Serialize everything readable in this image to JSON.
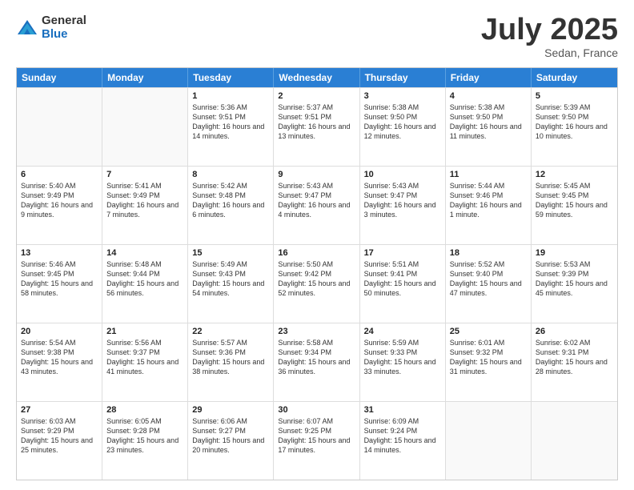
{
  "header": {
    "logo_general": "General",
    "logo_blue": "Blue",
    "month_title": "July 2025",
    "subtitle": "Sedan, France"
  },
  "days_of_week": [
    "Sunday",
    "Monday",
    "Tuesday",
    "Wednesday",
    "Thursday",
    "Friday",
    "Saturday"
  ],
  "weeks": [
    [
      {
        "day": "",
        "empty": true
      },
      {
        "day": "",
        "empty": true
      },
      {
        "day": "1",
        "sunrise": "5:36 AM",
        "sunset": "9:51 PM",
        "daylight": "16 hours and 14 minutes."
      },
      {
        "day": "2",
        "sunrise": "5:37 AM",
        "sunset": "9:51 PM",
        "daylight": "16 hours and 13 minutes."
      },
      {
        "day": "3",
        "sunrise": "5:38 AM",
        "sunset": "9:50 PM",
        "daylight": "16 hours and 12 minutes."
      },
      {
        "day": "4",
        "sunrise": "5:38 AM",
        "sunset": "9:50 PM",
        "daylight": "16 hours and 11 minutes."
      },
      {
        "day": "5",
        "sunrise": "5:39 AM",
        "sunset": "9:50 PM",
        "daylight": "16 hours and 10 minutes."
      }
    ],
    [
      {
        "day": "6",
        "sunrise": "5:40 AM",
        "sunset": "9:49 PM",
        "daylight": "16 hours and 9 minutes."
      },
      {
        "day": "7",
        "sunrise": "5:41 AM",
        "sunset": "9:49 PM",
        "daylight": "16 hours and 7 minutes."
      },
      {
        "day": "8",
        "sunrise": "5:42 AM",
        "sunset": "9:48 PM",
        "daylight": "16 hours and 6 minutes."
      },
      {
        "day": "9",
        "sunrise": "5:43 AM",
        "sunset": "9:47 PM",
        "daylight": "16 hours and 4 minutes."
      },
      {
        "day": "10",
        "sunrise": "5:43 AM",
        "sunset": "9:47 PM",
        "daylight": "16 hours and 3 minutes."
      },
      {
        "day": "11",
        "sunrise": "5:44 AM",
        "sunset": "9:46 PM",
        "daylight": "16 hours and 1 minute."
      },
      {
        "day": "12",
        "sunrise": "5:45 AM",
        "sunset": "9:45 PM",
        "daylight": "15 hours and 59 minutes."
      }
    ],
    [
      {
        "day": "13",
        "sunrise": "5:46 AM",
        "sunset": "9:45 PM",
        "daylight": "15 hours and 58 minutes."
      },
      {
        "day": "14",
        "sunrise": "5:48 AM",
        "sunset": "9:44 PM",
        "daylight": "15 hours and 56 minutes."
      },
      {
        "day": "15",
        "sunrise": "5:49 AM",
        "sunset": "9:43 PM",
        "daylight": "15 hours and 54 minutes."
      },
      {
        "day": "16",
        "sunrise": "5:50 AM",
        "sunset": "9:42 PM",
        "daylight": "15 hours and 52 minutes."
      },
      {
        "day": "17",
        "sunrise": "5:51 AM",
        "sunset": "9:41 PM",
        "daylight": "15 hours and 50 minutes."
      },
      {
        "day": "18",
        "sunrise": "5:52 AM",
        "sunset": "9:40 PM",
        "daylight": "15 hours and 47 minutes."
      },
      {
        "day": "19",
        "sunrise": "5:53 AM",
        "sunset": "9:39 PM",
        "daylight": "15 hours and 45 minutes."
      }
    ],
    [
      {
        "day": "20",
        "sunrise": "5:54 AM",
        "sunset": "9:38 PM",
        "daylight": "15 hours and 43 minutes."
      },
      {
        "day": "21",
        "sunrise": "5:56 AM",
        "sunset": "9:37 PM",
        "daylight": "15 hours and 41 minutes."
      },
      {
        "day": "22",
        "sunrise": "5:57 AM",
        "sunset": "9:36 PM",
        "daylight": "15 hours and 38 minutes."
      },
      {
        "day": "23",
        "sunrise": "5:58 AM",
        "sunset": "9:34 PM",
        "daylight": "15 hours and 36 minutes."
      },
      {
        "day": "24",
        "sunrise": "5:59 AM",
        "sunset": "9:33 PM",
        "daylight": "15 hours and 33 minutes."
      },
      {
        "day": "25",
        "sunrise": "6:01 AM",
        "sunset": "9:32 PM",
        "daylight": "15 hours and 31 minutes."
      },
      {
        "day": "26",
        "sunrise": "6:02 AM",
        "sunset": "9:31 PM",
        "daylight": "15 hours and 28 minutes."
      }
    ],
    [
      {
        "day": "27",
        "sunrise": "6:03 AM",
        "sunset": "9:29 PM",
        "daylight": "15 hours and 25 minutes."
      },
      {
        "day": "28",
        "sunrise": "6:05 AM",
        "sunset": "9:28 PM",
        "daylight": "15 hours and 23 minutes."
      },
      {
        "day": "29",
        "sunrise": "6:06 AM",
        "sunset": "9:27 PM",
        "daylight": "15 hours and 20 minutes."
      },
      {
        "day": "30",
        "sunrise": "6:07 AM",
        "sunset": "9:25 PM",
        "daylight": "15 hours and 17 minutes."
      },
      {
        "day": "31",
        "sunrise": "6:09 AM",
        "sunset": "9:24 PM",
        "daylight": "15 hours and 14 minutes."
      },
      {
        "day": "",
        "empty": true
      },
      {
        "day": "",
        "empty": true
      }
    ]
  ]
}
